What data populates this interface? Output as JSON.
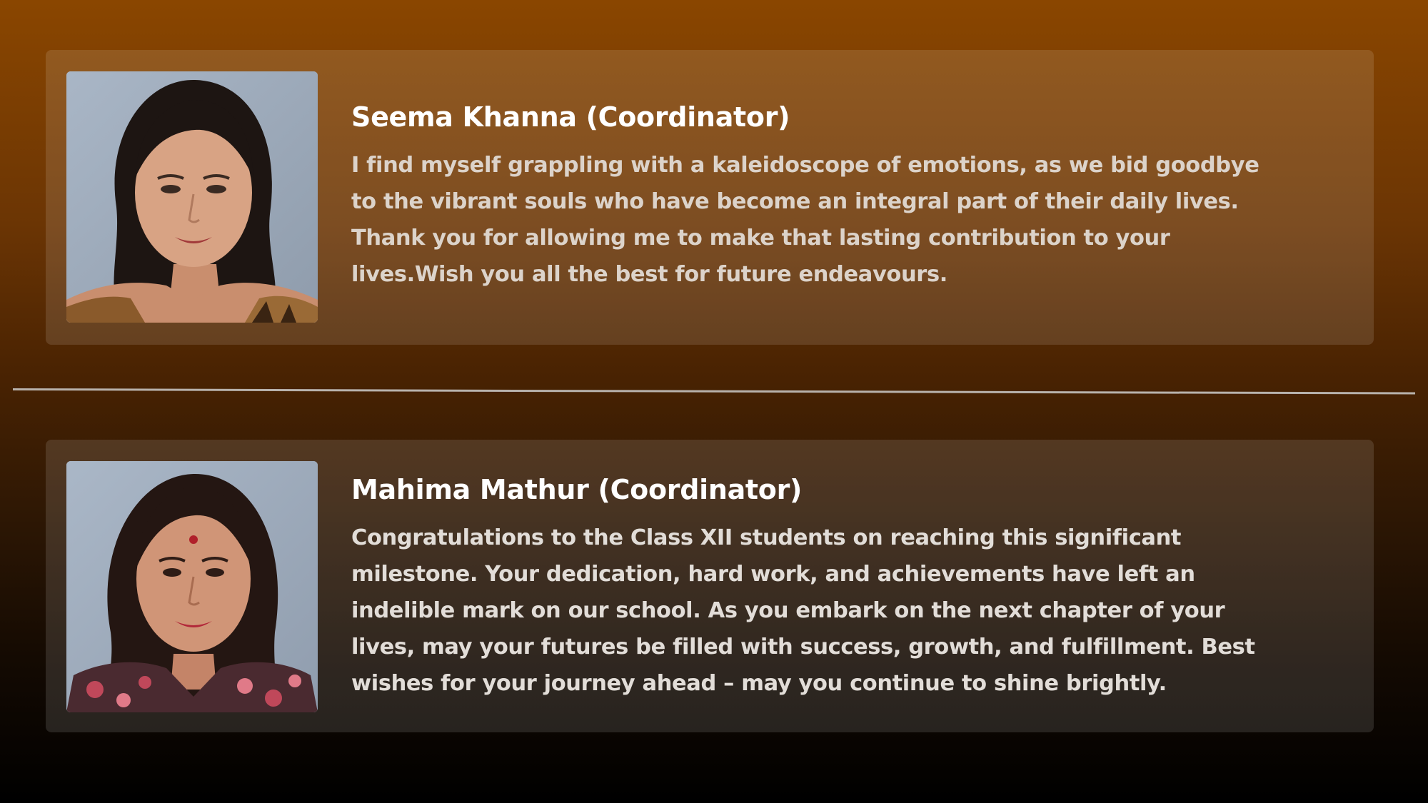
{
  "messages": [
    {
      "name": "Seema Khanna (Coordinator)",
      "text": "I find myself grappling with a kaleidoscope of emotions, as we bid goodbye to the vibrant souls who have become an integral part of their daily lives. Thank you for allowing me to make that lasting contribution to your lives.Wish you all the best for future endeavours."
    },
    {
      "name": "Mahima Mathur (Coordinator)",
      "text": "Congratulations to the Class XII students on reaching this significant milestone. Your dedication, hard work, and achievements have left an indelible mark on our school. As you embark on the next chapter of your lives, may your futures be filled with success, growth, and fulfillment. Best wishes for your journey ahead – may you continue to shine brightly."
    }
  ],
  "colors": {
    "background_top": "#8a4600",
    "background_bottom": "#000000",
    "name_text": "#ffffff",
    "message_text": "#dcd3ca",
    "divider": "#b8b2ac"
  }
}
